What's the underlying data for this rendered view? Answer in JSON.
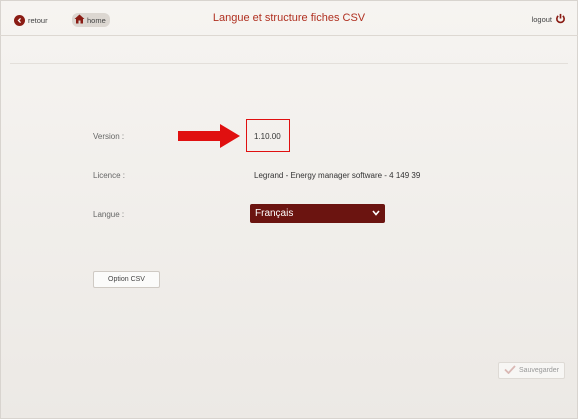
{
  "header": {
    "back_label": "retour",
    "home_label": "home",
    "title": "Langue et structure fiches CSV",
    "logout_label": "logout"
  },
  "form": {
    "version_label": "Version :",
    "version_value": "1.10.00",
    "licence_label": "Licence :",
    "licence_value": "Legrand - Energy manager software - 4 149 39",
    "langue_label": "Langue :",
    "langue_selected": "Français"
  },
  "buttons": {
    "option_csv": "Option CSV",
    "save": "Sauvegarder"
  },
  "colors": {
    "accent": "#8a1c14",
    "title": "#b03020",
    "select_bg": "#6b1410",
    "highlight": "#e01010"
  }
}
